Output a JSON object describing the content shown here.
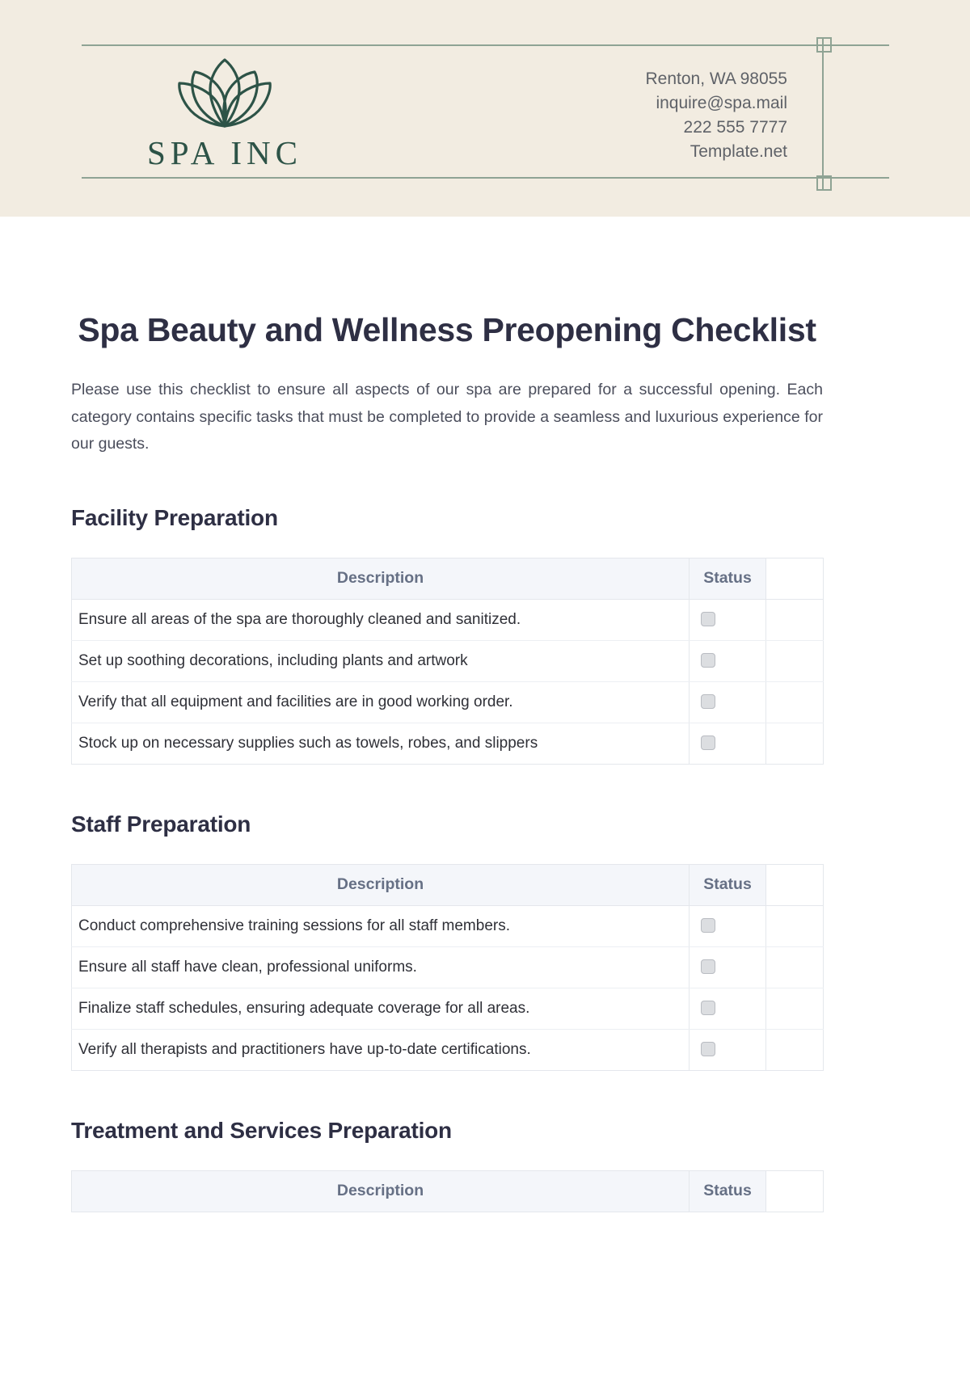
{
  "brand": {
    "name": "SPA INC",
    "logo_icon": "lotus-flower-icon",
    "accent_color": "#2d5347",
    "rule_color": "#8fa394",
    "band_color": "#f2ece1"
  },
  "contact": {
    "address": "Renton, WA 98055",
    "email": "inquire@spa.mail",
    "phone": "222 555 7777",
    "website": "Template.net"
  },
  "document": {
    "title": "Spa Beauty and Wellness Preopening Checklist",
    "intro": "Please use this checklist to ensure all aspects of our spa are prepared for a successful opening. Each category contains specific tasks that must be completed to provide a seamless and luxurious experience for our guests."
  },
  "table_headers": {
    "description": "Description",
    "status": "Status"
  },
  "sections": [
    {
      "heading": "Facility Preparation",
      "rows": [
        {
          "description": "Ensure all areas of the spa are thoroughly cleaned and sanitized.",
          "checked": false
        },
        {
          "description": "Set up soothing decorations, including plants and artwork",
          "checked": false
        },
        {
          "description": "Verify that all equipment and facilities are in good working order.",
          "checked": false
        },
        {
          "description": "Stock up on necessary supplies such as towels, robes, and slippers",
          "checked": false
        }
      ]
    },
    {
      "heading": "Staff Preparation",
      "rows": [
        {
          "description": "Conduct comprehensive training sessions for all staff members.",
          "checked": false
        },
        {
          "description": "Ensure all staff have clean, professional uniforms.",
          "checked": false
        },
        {
          "description": "Finalize staff schedules, ensuring adequate coverage for all areas.",
          "checked": false
        },
        {
          "description": "Verify all therapists and practitioners have up-to-date certifications.",
          "checked": false
        }
      ]
    },
    {
      "heading": "Treatment and Services Preparation",
      "rows": []
    }
  ]
}
